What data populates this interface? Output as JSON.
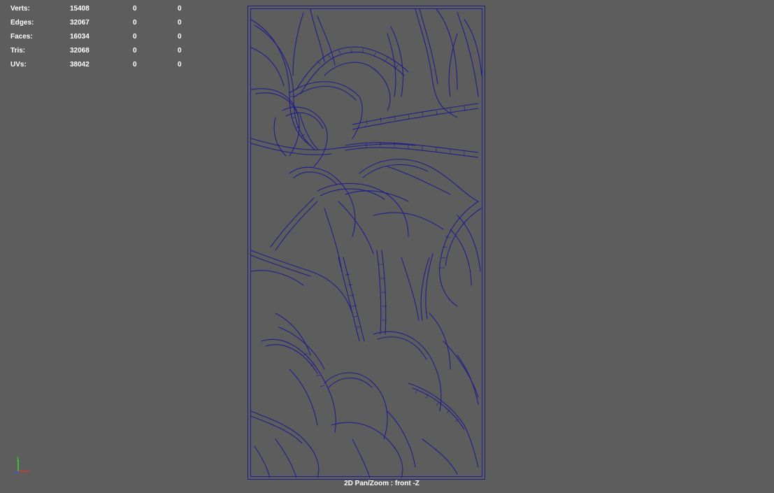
{
  "heads_up_display": {
    "rows": [
      {
        "label": "Verts:",
        "values": [
          "15408",
          "0",
          "0"
        ]
      },
      {
        "label": "Edges:",
        "values": [
          "32067",
          "0",
          "0"
        ]
      },
      {
        "label": "Faces:",
        "values": [
          "16034",
          "0",
          "0"
        ]
      },
      {
        "label": "Tris:",
        "values": [
          "32068",
          "0",
          "0"
        ]
      },
      {
        "label": "UVs:",
        "values": [
          "38042",
          "0",
          "0"
        ]
      }
    ]
  },
  "viewport": {
    "camera_label": "2D Pan/Zoom : front -Z",
    "background_color": "#5d5d5d",
    "wireframe_color": "#1f1f8a"
  },
  "axis_indicator": {
    "y_color": "#33dd33",
    "x_color": "#dd3333",
    "z_color": "#3355ee"
  },
  "icons": {
    "axis": "axis-gizmo-icon"
  }
}
